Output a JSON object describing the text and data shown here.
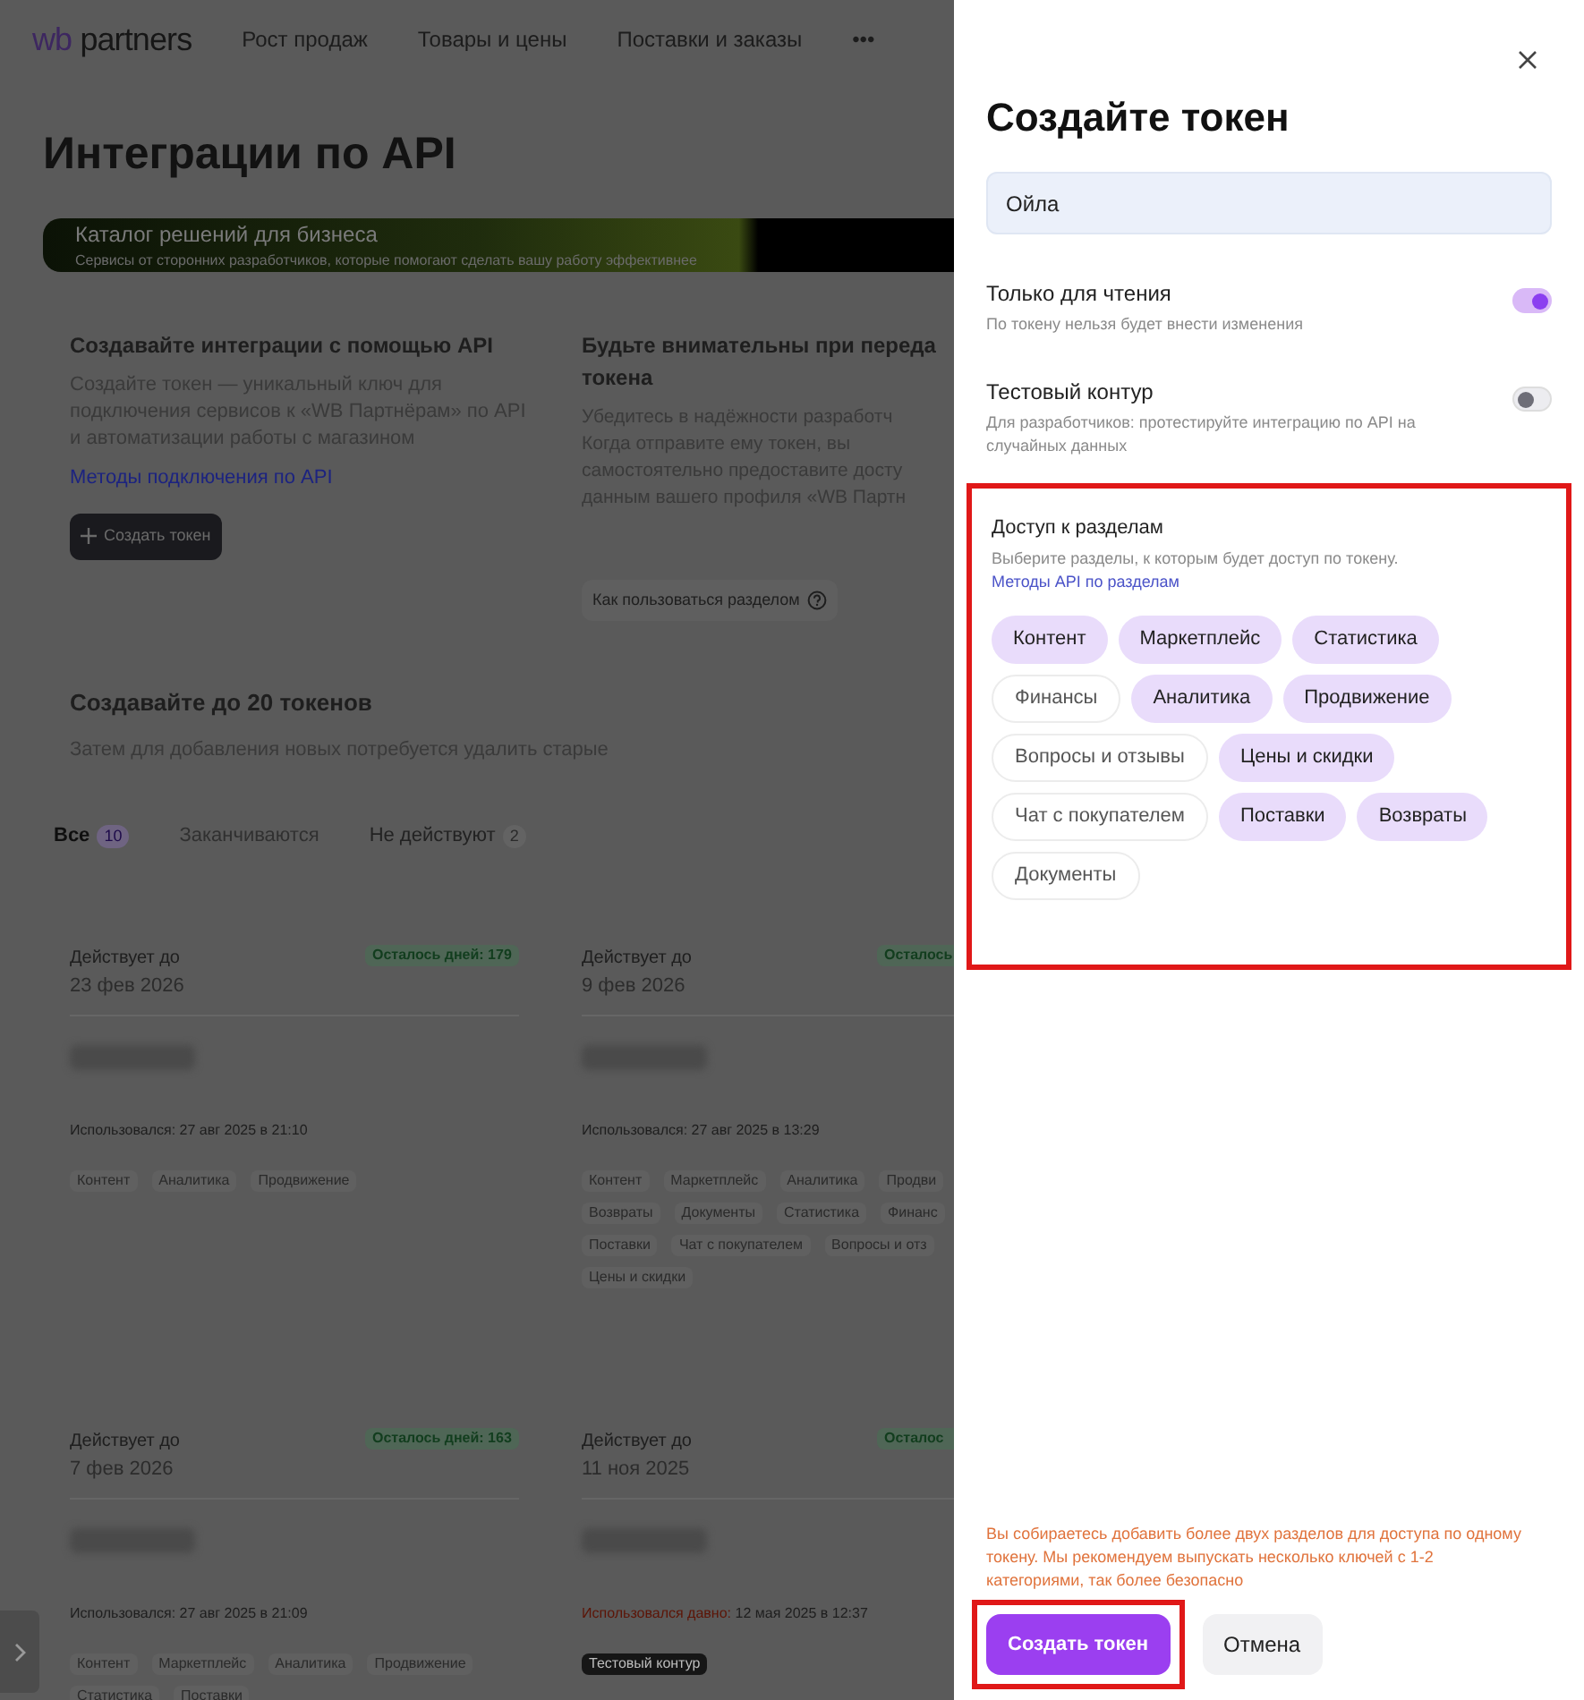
{
  "header": {
    "logo": {
      "prefix": "wb",
      "suffix": "partners"
    },
    "nav": [
      {
        "label": "Рост продаж"
      },
      {
        "label": "Товары и цены"
      },
      {
        "label": "Поставки и заказы"
      },
      {
        "label": "•••"
      }
    ]
  },
  "page_title": "Интеграции по API",
  "banner": {
    "title": "Каталог решений для бизнеса",
    "subtitle": "Сервисы от сторонних разработчиков, которые помогают сделать вашу работу эффективнее"
  },
  "info": [
    {
      "title": "Создавайте интеграции с помощью API",
      "text": "Создайте токен — уникальный ключ для подключения сервисов к «WB Партнёрам» по API и автоматизации работы с магазином",
      "link": "Методы подключения по API",
      "button": {
        "kind": "primary",
        "label": "Создать токен"
      }
    },
    {
      "title": "Будьте внимательны при переда",
      "title_rest": "токена",
      "lines": [
        "Убедитесь в надёжности разработч",
        "Когда отправите ему токен, вы",
        "самостоятельно предоставите досту",
        "данным вашего профиля «WB Партн"
      ],
      "button": {
        "kind": "help",
        "label": "Как пользоваться разделом"
      }
    }
  ],
  "limit": {
    "title": "Создавайте до 20 токенов",
    "text": "Затем для добавления новых потребуется удалить старые"
  },
  "filter_tabs": [
    {
      "label": "Все",
      "count": "10",
      "selected": true
    },
    {
      "label": "Заканчиваются",
      "selected": false
    },
    {
      "label": "Не действуют",
      "count": "2",
      "selected": false
    }
  ],
  "tokens": [
    {
      "valid_label": "Действует до",
      "date": "23 фев 2026",
      "badge": "Осталось дней: 179",
      "used_label": "Использовался:",
      "used": "27 авг 2025 в 21:10",
      "stale": false,
      "tag_rows": [
        [
          "Контент",
          "Аналитика",
          "Продвижение"
        ]
      ]
    },
    {
      "valid_label": "Действует до",
      "date": "9 фев 2026",
      "badge": "Осталось",
      "used_label": "Использовался:",
      "used": "27 авг 2025 в 13:29",
      "stale": false,
      "tag_rows": [
        [
          "Контент",
          "Маркетплейс",
          "Аналитика",
          "Продви"
        ],
        [
          "Возвраты",
          "Документы",
          "Статистика",
          "Финанс"
        ],
        [
          "Поставки",
          "Чат с покупателем",
          "Вопросы и отз"
        ],
        [
          "Цены и скидки"
        ]
      ]
    },
    {
      "valid_label": "Действует до",
      "date": "7 фев 2026",
      "badge": "Осталось дней: 163",
      "used_label": "Использовался:",
      "used": "27 авг 2025 в 21:09",
      "stale": false,
      "tag_rows": [
        [
          "Контент",
          "Маркетплейс",
          "Аналитика",
          "Продвижение"
        ],
        [
          "Статистика",
          "Поставки"
        ]
      ]
    },
    {
      "valid_label": "Действует до",
      "date": "11 ноя 2025",
      "badge": "Осталос",
      "used_label": "Использовался давно:",
      "used": "12 мая 2025 в 12:37",
      "stale": true,
      "test_tag": "Тестовый контур"
    }
  ],
  "panel": {
    "title": "Создайте токен",
    "name_field": {
      "value": "Ойла"
    },
    "toggles": [
      {
        "label": "Только для чтения",
        "hint": "По токену нельзя будет внести изменения",
        "on": true
      },
      {
        "label": "Тестовый контур",
        "hint": "Для разработчиков: протестируйте интеграцию по API на случайных данных",
        "on": false
      }
    ],
    "access": {
      "title": "Доступ к разделам",
      "hint": "Выберите разделы, к которым будет доступ по токену.",
      "link": "Методы API по разделам",
      "highlighted": true,
      "sections": [
        {
          "label": "Контент",
          "selected": true
        },
        {
          "label": "Маркетплейс",
          "selected": true
        },
        {
          "label": "Статистика",
          "selected": true
        },
        {
          "label": "Финансы",
          "selected": false
        },
        {
          "label": "Аналитика",
          "selected": true
        },
        {
          "label": "Продвижение",
          "selected": true
        },
        {
          "label": "Вопросы и отзывы",
          "selected": false
        },
        {
          "label": "Цены и скидки",
          "selected": true
        },
        {
          "label": "Чат с покупателем",
          "selected": false
        },
        {
          "label": "Поставки",
          "selected": true
        },
        {
          "label": "Возвраты",
          "selected": true
        },
        {
          "label": "Документы",
          "selected": false
        }
      ]
    },
    "warning": "Вы собираетесь добавить более двух разделов для доступа по одному токену. Мы рекомендуем выпускать несколько ключей с 1-2 категориями, так более безопасно",
    "create_button": {
      "label": "Создать токен",
      "highlighted": true
    },
    "cancel_button": {
      "label": "Отмена"
    }
  }
}
